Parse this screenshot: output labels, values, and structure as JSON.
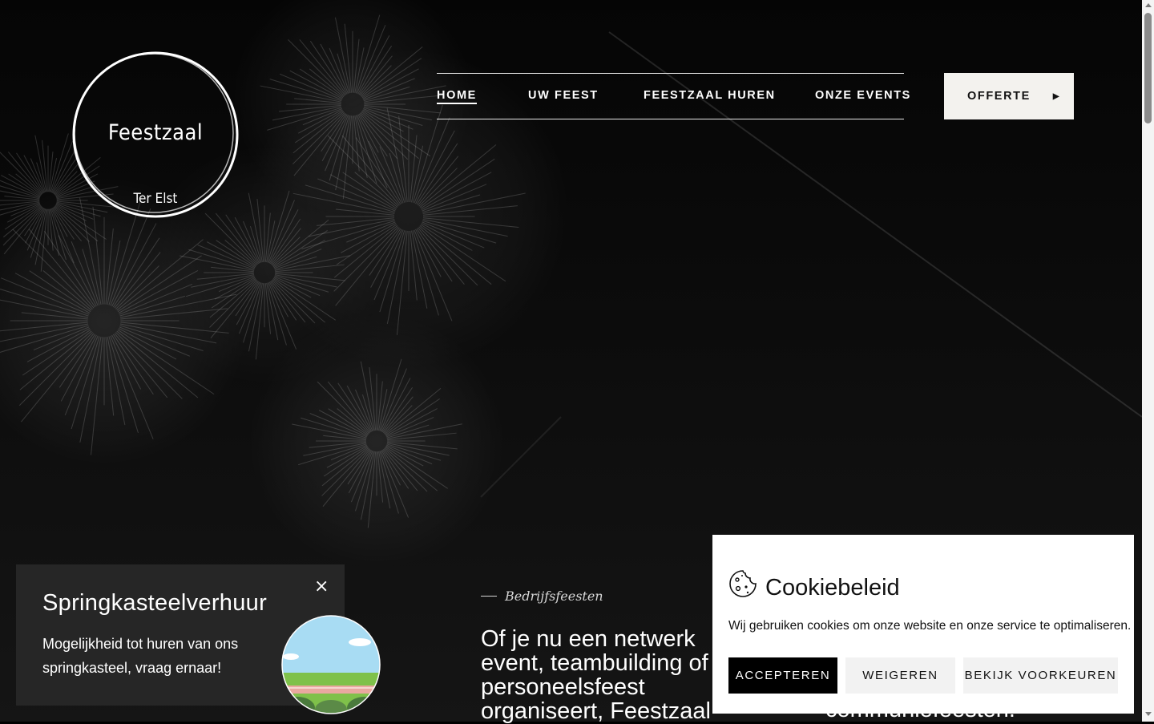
{
  "logo": {
    "title": "Feestzaal",
    "subtitle": "Ter Elst"
  },
  "nav": {
    "items": [
      {
        "label": "HOME",
        "active": true
      },
      {
        "label": "UW FEEST",
        "active": false
      },
      {
        "label": "FEESTZAAL HUREN",
        "active": false
      },
      {
        "label": "ONZE EVENTS",
        "active": false
      }
    ],
    "cta_label": "OFFERTE"
  },
  "hero": {
    "kicker": "Bedrijfsfeesten",
    "lead": "Of je nu een netwerk event, teambuilding of personeelsfeest organiseert, Feestzaal",
    "lead_right": "communiefeesten."
  },
  "promo": {
    "title": "Springkasteelverhuur",
    "text": "Mogelijkheid tot huren van ons springkasteel, vraag ernaar!",
    "close": "×"
  },
  "cookie": {
    "title": "Cookiebeleid",
    "text": "Wij gebruiken cookies om onze website en onze service te optimaliseren.",
    "accept": "ACCEPTEREN",
    "refuse": "WEIGEREN",
    "preferences": "BEKIJK VOORKEUREN"
  },
  "colors": {
    "background": "#000000",
    "cta_bg": "#f3f2ee",
    "promo_bg": "#262626",
    "cookie_bg": "#ffffff"
  }
}
